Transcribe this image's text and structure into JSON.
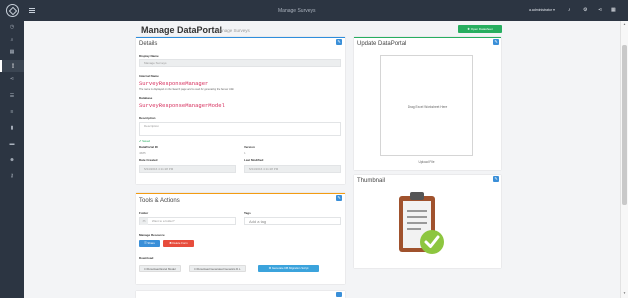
{
  "app": {
    "title": "Manage Surveys",
    "user": "a.administrator ▾"
  },
  "header": {
    "title": "Manage DataPortal",
    "subtitle": "Manage Surveys",
    "open_button": "Open Datasheet"
  },
  "details": {
    "title": "Details",
    "display_name_label": "Display Name",
    "display_name_value": "Manage Surveys",
    "internal_name_label": "Internal Name",
    "internal_name_value": "SurveyResponseManager",
    "internal_name_hint": "The name is displayed on the Search page and is used for generating the Server URL",
    "database_label": "Database",
    "database_value": "SurveyResponseManagerModel",
    "description_label": "Description",
    "description_placeholder": "Description",
    "saved_text": "✔ Saved",
    "id_label": "DataPortal ID",
    "id_value": "4685",
    "version_label": "Version",
    "version_value": "1",
    "created_label": "Date Created",
    "created_value": "5/24/2016 4:11:28 PM",
    "modified_label": "Last Modified",
    "modified_value": "5/24/2016 4:11:28 PM"
  },
  "tools": {
    "title": "Tools & Actions",
    "folder_label": "Folder",
    "folder_placeholder": "Want to a folder?",
    "tags_label": "Tags",
    "tags_placeholder": "Add a tag",
    "manage_label": "Manage Resource",
    "share_button": "Share",
    "delete_button": "Delete Form",
    "download_label": "Download",
    "download_excel": "Download Excel Model",
    "download_generated": "Download Generated Genetics D.L",
    "generate_script": "Generate DB Migration Script"
  },
  "update": {
    "title": "Update DataPortal",
    "dropzone_text": "Drag Excel Worksheet Here",
    "upload_text": "Upload File"
  },
  "thumbnail": {
    "title": "Thumbnail"
  },
  "colors": {
    "sidebar": "#2c3542",
    "accent_blue": "#2f8edc",
    "accent_green": "#27ae60",
    "accent_orange": "#f39c12",
    "danger": "#e74c3c"
  }
}
